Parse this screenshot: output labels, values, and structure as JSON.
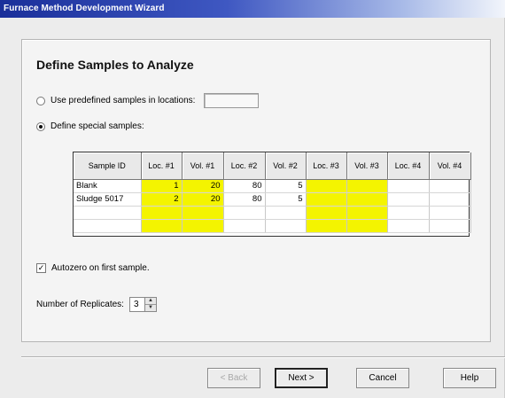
{
  "window": {
    "title": "Furnace Method Development Wizard"
  },
  "page": {
    "heading": "Define Samples to Analyze"
  },
  "options": {
    "predefined_label": "Use predefined samples in locations:",
    "predefined_value": "",
    "special_label": "Define special samples:",
    "selected": "special"
  },
  "grid": {
    "headers": [
      "Sample ID",
      "Loc. #1",
      "Vol. #1",
      "Loc. #2",
      "Vol. #2",
      "Loc. #3",
      "Vol. #3",
      "Loc. #4",
      "Vol. #4"
    ],
    "highlight_color": "#f4f400",
    "rows": [
      [
        "Blank",
        "1",
        "20",
        "80",
        "5",
        "",
        "",
        "",
        ""
      ],
      [
        "Sludge 5017",
        "2",
        "20",
        "80",
        "5",
        "",
        "",
        "",
        ""
      ],
      [
        "",
        "",
        "",
        "",
        "",
        "",
        "",
        "",
        ""
      ],
      [
        "",
        "",
        "",
        "",
        "",
        "",
        "",
        "",
        ""
      ]
    ]
  },
  "autozero": {
    "label": "Autozero on first sample.",
    "checked": true
  },
  "replicates": {
    "label": "Number of Replicates:",
    "value": "3"
  },
  "buttons": {
    "back": "< Back",
    "next": "Next >",
    "cancel": "Cancel",
    "help": "Help"
  }
}
